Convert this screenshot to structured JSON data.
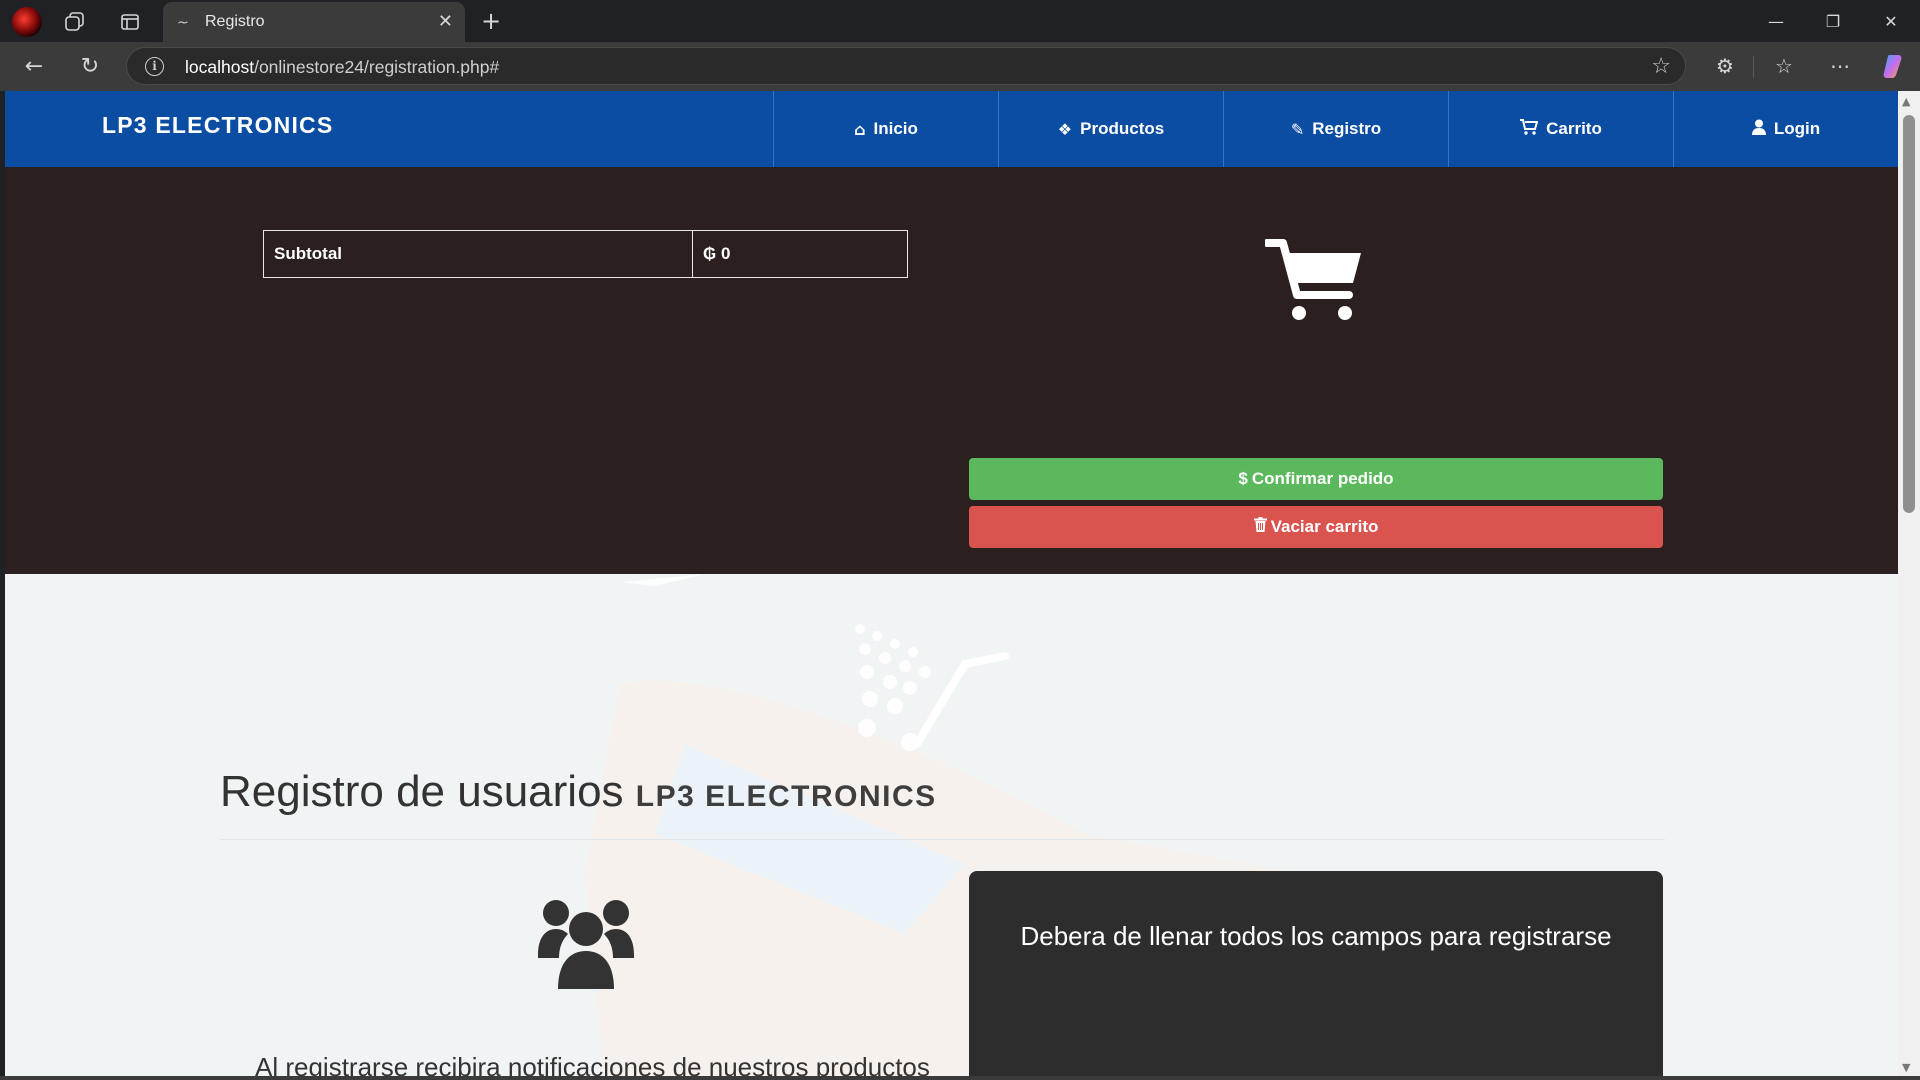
{
  "browser": {
    "tab_title": "Registro",
    "url_host": "localhost",
    "url_path": "/onlinestore24/registration.php#"
  },
  "navbar": {
    "brand": "LP3 ELECTRONICS",
    "items": [
      {
        "label": "Inicio",
        "icon": "home-icon"
      },
      {
        "label": "Productos",
        "icon": "dropbox-icon"
      },
      {
        "label": "Registro",
        "icon": "edit-icon"
      },
      {
        "label": "Carrito",
        "icon": "cart-icon"
      },
      {
        "label": "Login",
        "icon": "user-icon"
      }
    ]
  },
  "cart": {
    "subtotal_label": "Subtotal",
    "subtotal_value": "₲ 0",
    "confirm_label": "Confirmar pedido",
    "empty_label": "Vaciar carrito"
  },
  "registration": {
    "title": "Registro de usuarios",
    "title_brand": "LP3 ELECTRONICS",
    "partial_text": "Al registrarse recibira notificaciones de nuestros productos",
    "notice": "Debera de llenar todos los campos para registrarse"
  },
  "colors": {
    "navbar": "#0b4da2",
    "cart_section": "#2b1f20",
    "confirm": "#5cb85c",
    "danger": "#d9534f"
  }
}
